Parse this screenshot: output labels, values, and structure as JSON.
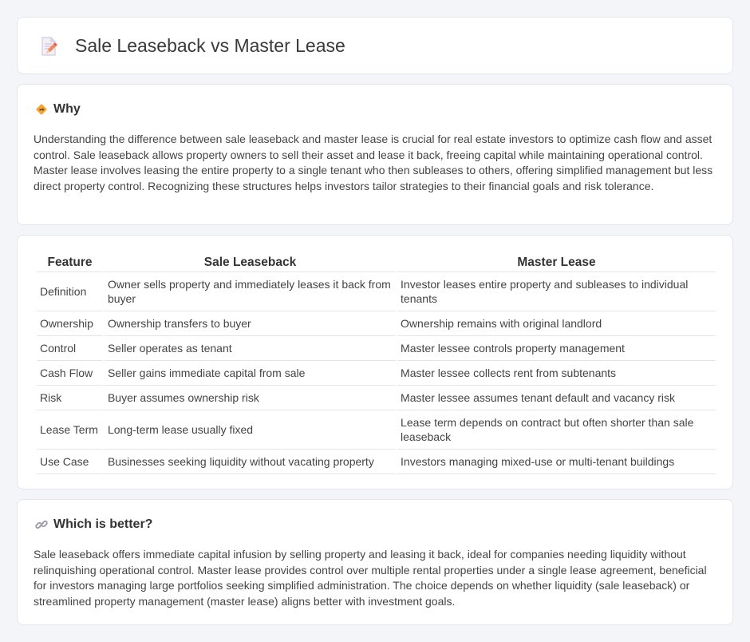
{
  "header": {
    "title": "Sale Leaseback vs Master Lease",
    "icon": "document-pencil-icon"
  },
  "why": {
    "title": "Why",
    "icon": "diamond-directions-icon",
    "text": "Understanding the difference between sale leaseback and master lease is crucial for real estate investors to optimize cash flow and asset control. Sale leaseback allows property owners to sell their asset and lease it back, freeing capital while maintaining operational control. Master lease involves leasing the entire property to a single tenant who then subleases to others, offering simplified management but less direct property control. Recognizing these structures helps investors tailor strategies to their financial goals and risk tolerance."
  },
  "table": {
    "headers": [
      "Feature",
      "Sale Leaseback",
      "Master Lease"
    ],
    "rows": [
      [
        "Definition",
        "Owner sells property and immediately leases it back from buyer",
        "Investor leases entire property and subleases to individual tenants"
      ],
      [
        "Ownership",
        "Ownership transfers to buyer",
        "Ownership remains with original landlord"
      ],
      [
        "Control",
        "Seller operates as tenant",
        "Master lessee controls property management"
      ],
      [
        "Cash Flow",
        "Seller gains immediate capital from sale",
        "Master lessee collects rent from subtenants"
      ],
      [
        "Risk",
        "Buyer assumes ownership risk",
        "Master lessee assumes tenant default and vacancy risk"
      ],
      [
        "Lease Term",
        "Long-term lease usually fixed",
        "Lease term depends on contract but often shorter than sale leaseback"
      ],
      [
        "Use Case",
        "Businesses seeking liquidity without vacating property",
        "Investors managing mixed-use or multi-tenant buildings"
      ]
    ]
  },
  "better": {
    "title": "Which is better?",
    "icon": "link-icon",
    "text": "Sale leaseback offers immediate capital infusion by selling property and leasing it back, ideal for companies needing liquidity without relinquishing operational control. Master lease provides control over multiple rental properties under a single lease agreement, beneficial for investors managing large portfolios seeking simplified administration. The choice depends on whether liquidity (sale leaseback) or streamlined property management (master lease) aligns better with investment goals."
  }
}
